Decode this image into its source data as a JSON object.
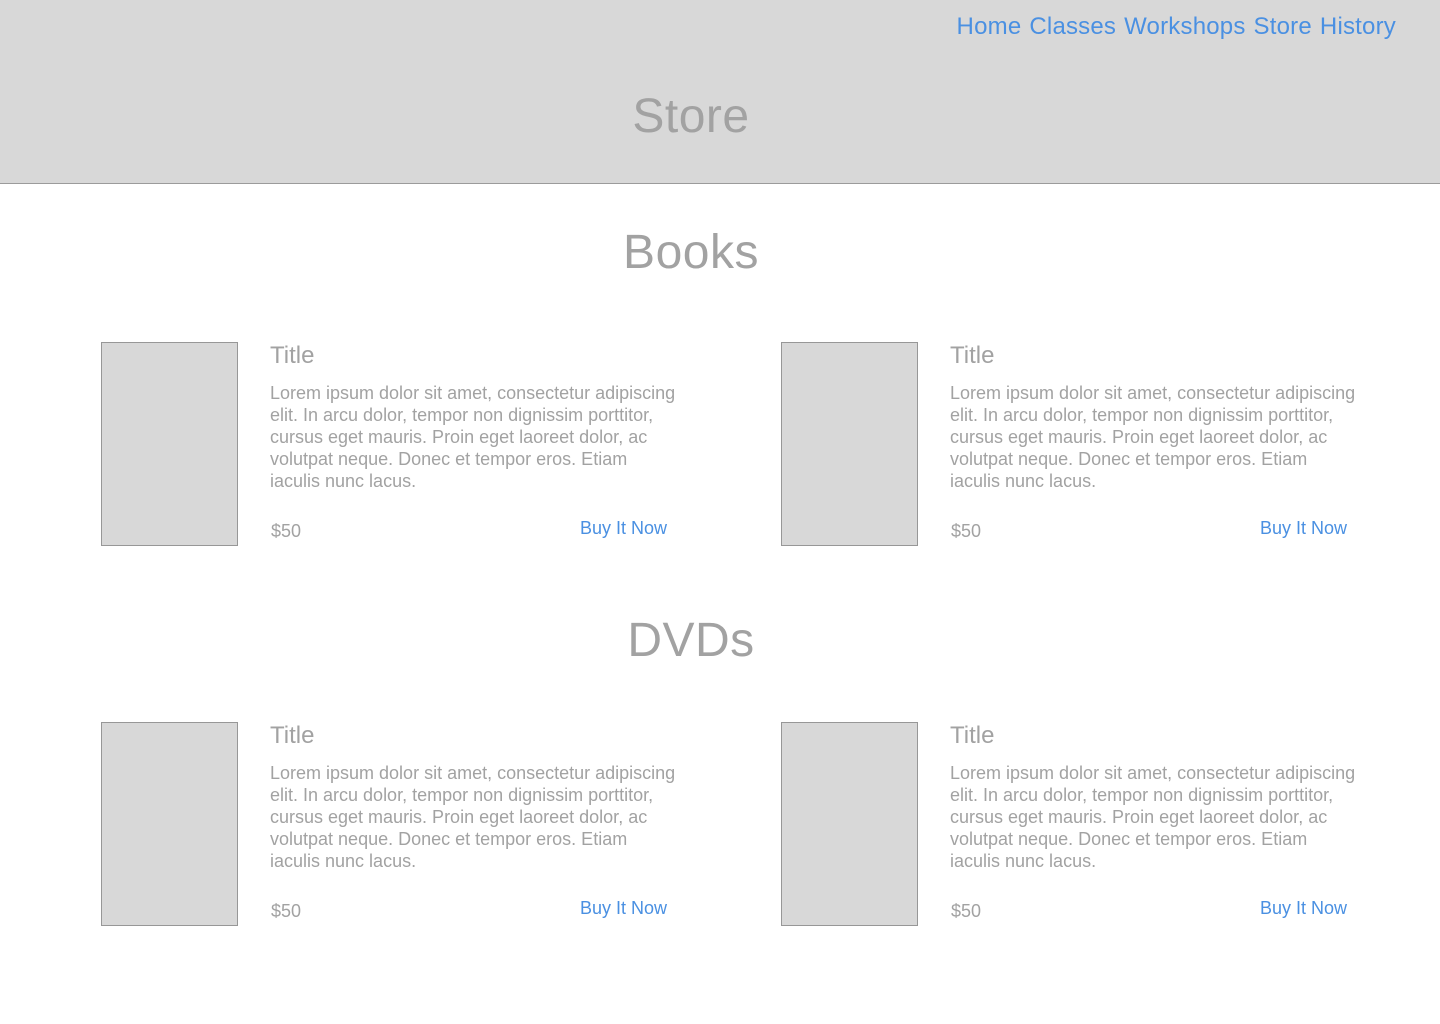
{
  "nav": {
    "items": [
      "Home",
      "Classes",
      "Workshops",
      "Store",
      "History"
    ]
  },
  "page_title": "Store",
  "sections": [
    {
      "title": "Books",
      "products": [
        {
          "title": "Title",
          "description": "Lorem ipsum dolor sit amet, consectetur adipiscing elit. In arcu dolor, tempor non dignissim porttitor, cursus eget mauris. Proin eget laoreet dolor, ac volutpat neque. Donec et tempor eros. Etiam iaculis nunc lacus.",
          "price": "$50",
          "buy_label": "Buy It Now"
        },
        {
          "title": "Title",
          "description": "Lorem ipsum dolor sit amet, consectetur adipiscing elit. In arcu dolor, tempor non dignissim porttitor, cursus eget mauris. Proin eget laoreet dolor, ac volutpat neque. Donec et tempor eros. Etiam iaculis nunc lacus.",
          "price": "$50",
          "buy_label": "Buy It Now"
        }
      ]
    },
    {
      "title": "DVDs",
      "products": [
        {
          "title": "Title",
          "description": "Lorem ipsum dolor sit amet, consectetur adipiscing elit. In arcu dolor, tempor non dignissim porttitor, cursus eget mauris. Proin eget laoreet dolor, ac volutpat neque. Donec et tempor eros. Etiam iaculis nunc lacus.",
          "price": "$50",
          "buy_label": "Buy It Now"
        },
        {
          "title": "Title",
          "description": "Lorem ipsum dolor sit amet, consectetur adipiscing elit. In arcu dolor, tempor non dignissim porttitor, cursus eget mauris. Proin eget laoreet dolor, ac volutpat neque. Donec et tempor eros. Etiam iaculis nunc lacus.",
          "price": "$50",
          "buy_label": "Buy It Now"
        }
      ]
    }
  ],
  "colors": {
    "header_bg": "#d8d8d8",
    "link": "#4a90e2",
    "text": "#a2a2a2",
    "placeholder": "#d8d8d8"
  }
}
